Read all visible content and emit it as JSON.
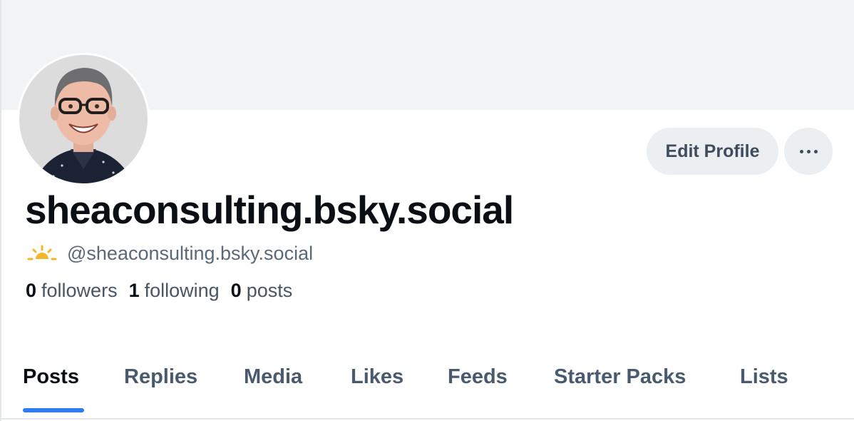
{
  "profile": {
    "display_name": "sheaconsulting.bsky.social",
    "handle": "@sheaconsulting.bsky.social",
    "handle_icon": "sunrise-icon",
    "avatar": "profile-photo"
  },
  "actions": {
    "edit_profile_label": "Edit Profile",
    "more_icon": "ellipsis-icon"
  },
  "stats": [
    {
      "value": "0",
      "label": "followers"
    },
    {
      "value": "1",
      "label": "following"
    },
    {
      "value": "0",
      "label": "posts"
    }
  ],
  "tabs": [
    {
      "label": "Posts",
      "active": true
    },
    {
      "label": "Replies"
    },
    {
      "label": "Media"
    },
    {
      "label": "Likes"
    },
    {
      "label": "Feeds"
    },
    {
      "label": "Starter Packs"
    },
    {
      "label": "Lists"
    }
  ],
  "colors": {
    "banner": "#f1f3f5",
    "accent": "#2f7bf0",
    "button_bg": "#eceff2",
    "text_primary": "#0b0f14",
    "text_secondary": "#5b6877",
    "icon_yellow": "#f2b52e"
  }
}
